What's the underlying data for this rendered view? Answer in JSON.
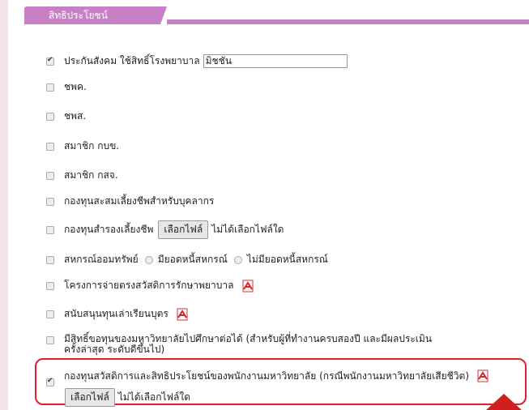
{
  "section": {
    "title": "สิทธิประโยชน์"
  },
  "colors": {
    "accent": "#c77fc5",
    "highlight": "#e0202a"
  },
  "items": [
    {
      "label": "ประกันสังคม ใช้สิทธิ์โรงพยาบาล",
      "checked": true,
      "input_value": "มิชชั่น"
    },
    {
      "label": "ชพค.",
      "checked": false
    },
    {
      "label": "ชพส.",
      "checked": false
    },
    {
      "label": "สมาชิก กบข.",
      "checked": false
    },
    {
      "label": "สมาชิก กสจ.",
      "checked": false
    },
    {
      "label": "กองทุนสะสมเลี้ยงชีพสำหรับบุคลากร",
      "checked": false
    },
    {
      "label": "กองทุนสำรองเลี้ยงชีพ",
      "checked": false,
      "file_button": "เลือกไฟล์",
      "file_status": "ไม่ได้เลือกไฟล์ใด"
    },
    {
      "label": "สหกรณ์ออมทรัพย์",
      "checked": false,
      "radio1": "มียอดหนี้สหกรณ์",
      "radio2": "ไม่มียอดหนี้สหกรณ์"
    },
    {
      "label": "โครงการจ่ายตรงสวัสดิการรักษาพยาบาล",
      "checked": false,
      "icon": "pdf-icon"
    },
    {
      "label": "สนับสนุนทุนเล่าเรียนบุตร",
      "checked": false,
      "icon": "pdf-icon"
    },
    {
      "label": "มีสิทธิ์ขอทุนของมหาวิทยาลัยไปศึกษาต่อได้ (สำหรับผู้ที่ทำงานครบสองปี และมีผลประเมินครั้งล่าสุด ระดับดีขึ้นไป)",
      "checked": false
    },
    {
      "label": "กองทุนสวัสดิการและสิทธิประโยชน์ของพนักงานมหาวิทยาลัย (กรณีพนักงานมหาวิทยาลัยเสียชีวิต)",
      "checked": true,
      "icon": "pdf-icon",
      "file_button": "เลือกไฟล์",
      "file_status": "ไม่ได้เลือกไฟล์ใด"
    }
  ]
}
